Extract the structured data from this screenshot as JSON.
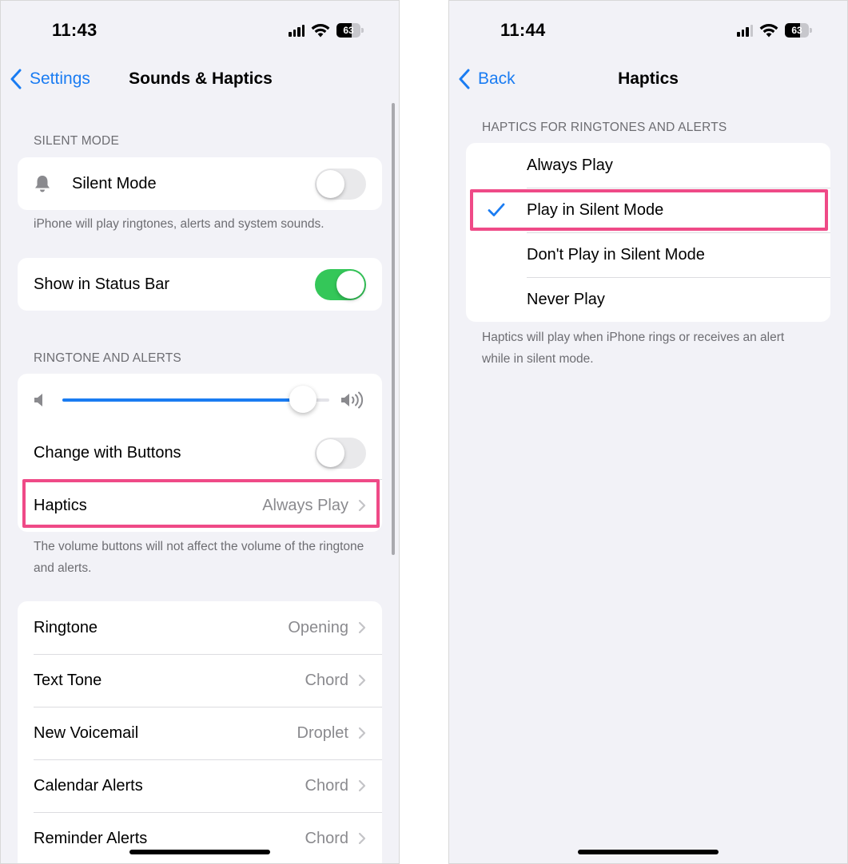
{
  "left_screen": {
    "status": {
      "time": "11:43",
      "battery": "63"
    },
    "nav": {
      "back_label": "Settings",
      "title": "Sounds & Haptics"
    },
    "silent_section": {
      "header": "SILENT MODE",
      "silent_mode_label": "Silent Mode",
      "silent_mode_on": false,
      "footer": "iPhone will play ringtones, alerts and system sounds."
    },
    "status_bar_row": {
      "label": "Show in Status Bar",
      "on": true
    },
    "ringtone_section": {
      "header": "RINGTONE AND ALERTS",
      "volume_level": 0.9,
      "change_with_buttons_label": "Change with Buttons",
      "change_with_buttons_on": false,
      "haptics_label": "Haptics",
      "haptics_value": "Always Play",
      "footer": "The volume buttons will not affect the volume of the ringtone and alerts."
    },
    "tones": [
      {
        "label": "Ringtone",
        "value": "Opening"
      },
      {
        "label": "Text Tone",
        "value": "Chord"
      },
      {
        "label": "New Voicemail",
        "value": "Droplet"
      },
      {
        "label": "Calendar Alerts",
        "value": "Chord"
      },
      {
        "label": "Reminder Alerts",
        "value": "Chord"
      }
    ]
  },
  "right_screen": {
    "status": {
      "time": "11:44",
      "battery": "63"
    },
    "nav": {
      "back_label": "Back",
      "title": "Haptics"
    },
    "section_header": "HAPTICS FOR RINGTONES AND ALERTS",
    "options": [
      {
        "label": "Always Play",
        "selected": false
      },
      {
        "label": "Play in Silent Mode",
        "selected": true
      },
      {
        "label": "Don't Play in Silent Mode",
        "selected": false
      },
      {
        "label": "Never Play",
        "selected": false
      }
    ],
    "footer": "Haptics will play when iPhone rings or receives an alert while in silent mode."
  },
  "colors": {
    "accent": "#1a7cf2",
    "toggle_on": "#34c759",
    "highlight": "#ef4a87",
    "background": "#f2f2f7"
  },
  "icons": [
    "back-chevron-icon",
    "bell-icon",
    "speaker-low-icon",
    "speaker-high-icon",
    "chevron-right-icon",
    "checkmark-icon",
    "signal-icon",
    "wifi-icon",
    "battery-icon"
  ]
}
